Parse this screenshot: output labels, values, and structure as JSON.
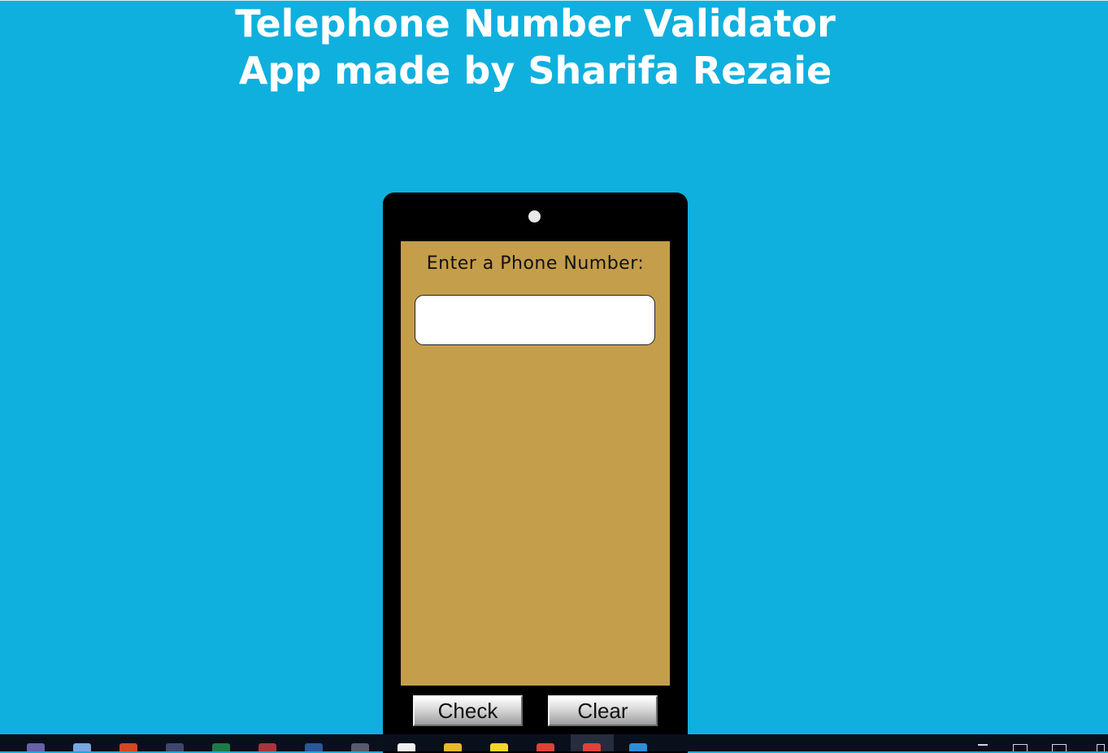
{
  "page": {
    "title": "Telephone Number Validator App made by Sharifa Rezaie",
    "background_color": "#0fb0de"
  },
  "phone": {
    "prompt": "Enter a Phone Number:",
    "input_value": "",
    "screen_color": "#c49e4a",
    "buttons": {
      "check_label": "Check",
      "clear_label": "Clear"
    }
  },
  "taskbar": {
    "apps": [
      {
        "name": "teams-icon",
        "color": "#6264a7"
      },
      {
        "name": "globe-icon",
        "color": "#7aa6e0"
      },
      {
        "name": "powerpoint-icon",
        "color": "#d24726"
      },
      {
        "name": "calculator-icon",
        "color": "#3b4a6b"
      },
      {
        "name": "excel-icon",
        "color": "#1d7a45"
      },
      {
        "name": "access-icon",
        "color": "#a4373a"
      },
      {
        "name": "word-icon",
        "color": "#2b579a"
      },
      {
        "name": "camera-icon",
        "color": "#555c6b"
      },
      {
        "name": "document-icon",
        "color": "#f0f0f0"
      },
      {
        "name": "folder-icon",
        "color": "#e8b92c"
      },
      {
        "name": "sticky-notes-icon",
        "color": "#f7d62a"
      },
      {
        "name": "chrome-icon",
        "color": "#db4437"
      },
      {
        "name": "chrome-active-icon",
        "color": "#db4437"
      },
      {
        "name": "vscode-icon",
        "color": "#2a8fd9"
      }
    ]
  }
}
